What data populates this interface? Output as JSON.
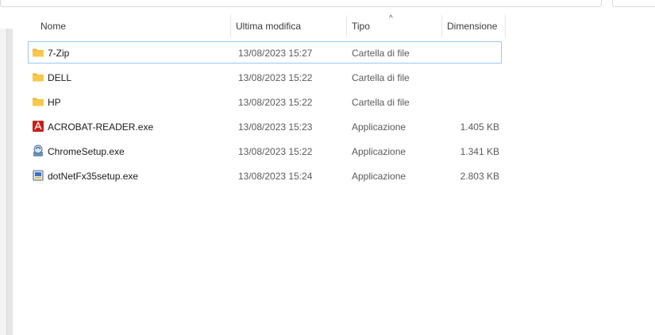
{
  "columns": {
    "name": "Nome",
    "modified": "Ultima modifica",
    "type": "Tipo",
    "size": "Dimensione"
  },
  "sort_indicator": "^",
  "files": [
    {
      "name": "7-Zip",
      "modified": "13/08/2023 15:27",
      "type": "Cartella di file",
      "size": "",
      "icon": "folder-icon",
      "selected": true
    },
    {
      "name": "DELL",
      "modified": "13/08/2023 15:22",
      "type": "Cartella di file",
      "size": "",
      "icon": "folder-icon"
    },
    {
      "name": "HP",
      "modified": "13/08/2023 15:22",
      "type": "Cartella di file",
      "size": "",
      "icon": "folder-icon"
    },
    {
      "name": "ACROBAT-READER.exe",
      "modified": "13/08/2023 15:23",
      "type": "Applicazione",
      "size": "1.405 KB",
      "icon": "acrobat-icon"
    },
    {
      "name": "ChromeSetup.exe",
      "modified": "13/08/2023 15:22",
      "type": "Applicazione",
      "size": "1.341 KB",
      "icon": "installer-icon"
    },
    {
      "name": "dotNetFx35setup.exe",
      "modified": "13/08/2023 15:24",
      "type": "Applicazione",
      "size": "2.803 KB",
      "icon": "setup-icon"
    }
  ],
  "colors": {
    "folder": "#f8c94a",
    "selection_border": "#99c9ef",
    "acrobat": "#c7201c"
  }
}
